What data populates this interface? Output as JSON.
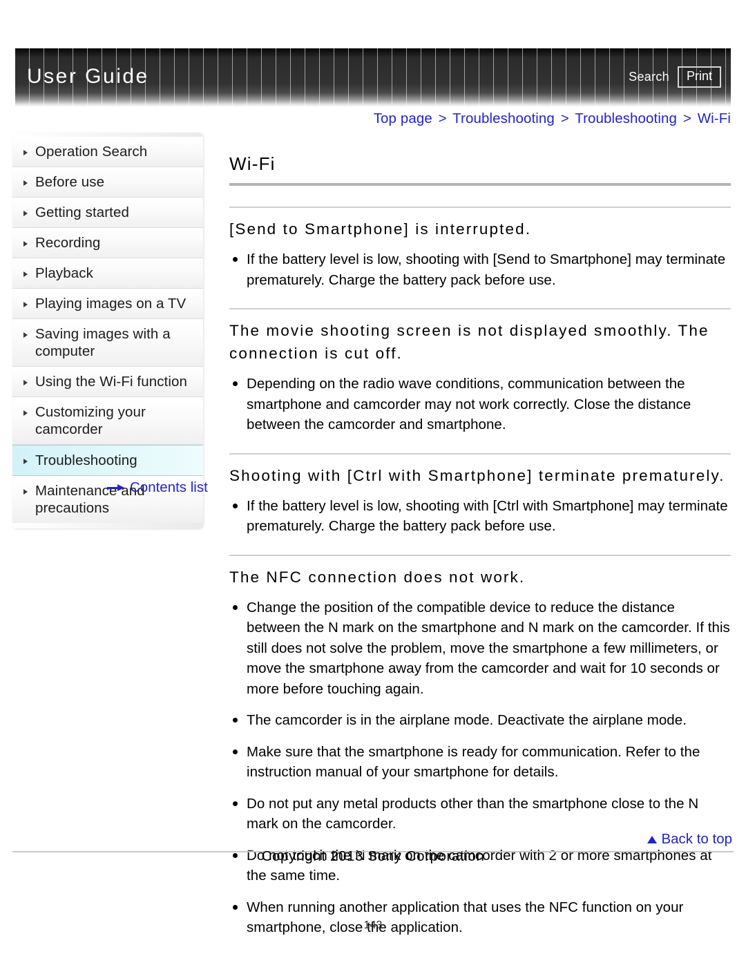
{
  "header": {
    "title": "User Guide",
    "search_label": "Search",
    "print_label": "Print"
  },
  "breadcrumb": {
    "separator": ">",
    "items": [
      {
        "label": "Top page"
      },
      {
        "label": "Troubleshooting"
      },
      {
        "label": "Troubleshooting"
      },
      {
        "label": "Wi-Fi"
      }
    ]
  },
  "sidebar": {
    "items": [
      {
        "label": "Operation Search",
        "active": false
      },
      {
        "label": "Before use",
        "active": false
      },
      {
        "label": "Getting started",
        "active": false
      },
      {
        "label": "Recording",
        "active": false
      },
      {
        "label": "Playback",
        "active": false
      },
      {
        "label": "Playing images on a TV",
        "active": false
      },
      {
        "label": "Saving images with a computer",
        "active": false
      },
      {
        "label": "Using the Wi-Fi function",
        "active": false
      },
      {
        "label": "Customizing your camcorder",
        "active": false
      },
      {
        "label": "Troubleshooting",
        "active": true
      },
      {
        "label": "Maintenance and precautions",
        "active": false
      }
    ],
    "contents_link_label": "Contents list"
  },
  "main": {
    "page_title": "Wi-Fi",
    "sections": [
      {
        "heading": "[Send to Smartphone] is interrupted.",
        "bullets": [
          "If the battery level is low, shooting with [Send to Smartphone] may terminate prematurely. Charge the battery pack before use."
        ]
      },
      {
        "heading": "The movie shooting screen is not displayed smoothly. The connection is cut off.",
        "bullets": [
          "Depending on the radio wave conditions, communication between the smartphone and camcorder may not work correctly. Close the distance between the camcorder and smartphone."
        ]
      },
      {
        "heading": "Shooting with [Ctrl with Smartphone] terminate prematurely.",
        "bullets": [
          "If the battery level is low, shooting with [Ctrl with Smartphone] may terminate prematurely. Charge the battery pack before use."
        ]
      },
      {
        "heading": "The NFC connection does not work.",
        "bullets": [
          "Change the position of the compatible device to reduce the distance between the N mark on the smartphone and N mark on the camcorder. If this still does not solve the problem, move the smartphone a few millimeters, or move the smartphone away from the camcorder and wait for 10 seconds or more before touching again.",
          "The camcorder is in the airplane mode. Deactivate the airplane mode.",
          "Make sure that the smartphone is ready for communication. Refer to the instruction manual of your smartphone for details.",
          "Do not put any metal products other than the smartphone close to the N mark on the camcorder.",
          "Do not touch the N mark on the camcorder with 2 or more smartphones at the same time.",
          "When running another application that uses the NFC function on your smartphone, close the application."
        ]
      }
    ]
  },
  "footer": {
    "back_to_top_label": "Back to top",
    "copyright": "Copyright 2013 Sony Corporation",
    "page_number": "143"
  },
  "colors": {
    "link": "#2323c8",
    "active_nav": "#d2f2f8",
    "header_bg": "#2b2b2b"
  }
}
